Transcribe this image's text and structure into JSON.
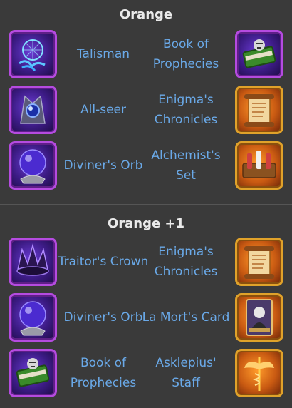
{
  "sections": [
    {
      "title": "Orange",
      "rows": [
        {
          "left": {
            "label": "Talisman",
            "icon": "dreamcatcher-talisman-icon"
          },
          "right": {
            "label": "Book of Prophecies",
            "icon": "book-of-prophecies-icon"
          }
        },
        {
          "left": {
            "label": "All-seer",
            "icon": "all-seer-icon"
          },
          "right": {
            "label": "Enigma's Chronicles",
            "icon": "scroll-icon"
          }
        },
        {
          "left": {
            "label": "Diviner's Orb",
            "icon": "crystal-orb-icon"
          },
          "right": {
            "label": "Alchemist's Set",
            "icon": "alchemist-set-icon"
          }
        }
      ]
    },
    {
      "title": "Orange +1",
      "rows": [
        {
          "left": {
            "label": "Traitor's Crown",
            "icon": "crown-icon"
          },
          "right": {
            "label": "Enigma's Chronicles",
            "icon": "scroll-icon"
          }
        },
        {
          "left": {
            "label": "Diviner's Orb",
            "icon": "crystal-orb-icon"
          },
          "right": {
            "label": "La Mort's Card",
            "icon": "death-card-icon"
          }
        },
        {
          "left": {
            "label": "Book of Prophecies",
            "icon": "book-of-prophecies-icon"
          },
          "right": {
            "label": "Asklepius' Staff",
            "icon": "winged-staff-icon"
          }
        }
      ]
    }
  ],
  "colors": {
    "background": "#3a3a3a",
    "title": "#eaeaea",
    "label": "#6aa9e8",
    "purple_frame": "#b54be0",
    "gold_frame": "#e0a22a"
  }
}
